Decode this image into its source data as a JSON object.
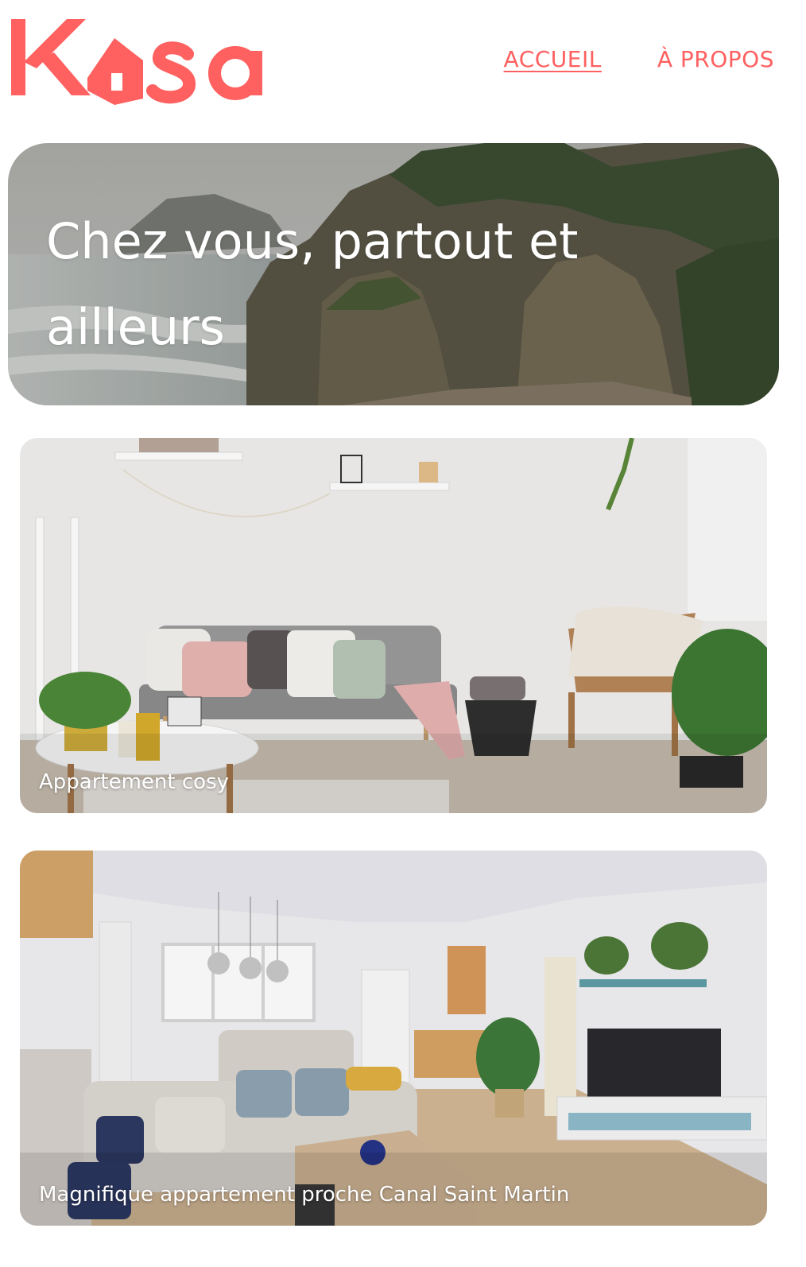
{
  "brand": {
    "name": "Kasa",
    "accent_color": "#ff6060"
  },
  "nav": {
    "items": [
      {
        "label": "ACCUEIL",
        "active": true
      },
      {
        "label": "À PROPOS",
        "active": false
      }
    ]
  },
  "hero": {
    "title": "Chez vous, partout et ailleurs"
  },
  "listings": [
    {
      "title": "Appartement cosy"
    },
    {
      "title": "Magnifique appartement proche Canal Saint Martin"
    }
  ]
}
